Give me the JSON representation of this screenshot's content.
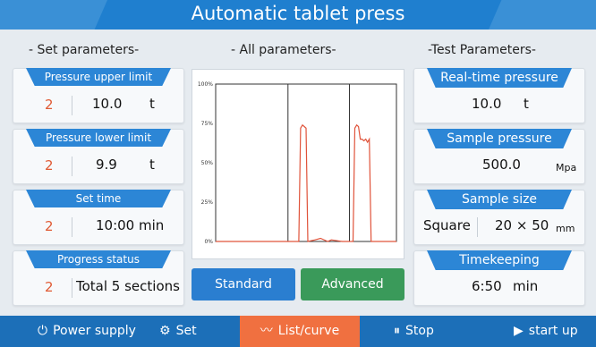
{
  "header": {
    "title": "Automatic tablet press"
  },
  "sections": {
    "set": "- Set parameters-",
    "all": "- All parameters-",
    "test": "-Test Parameters-"
  },
  "set_params": [
    {
      "label": "Pressure upper limit",
      "index": "2",
      "value": "10.0",
      "unit": "t"
    },
    {
      "label": "Pressure lower limit",
      "index": "2",
      "value": "9.9",
      "unit": "t"
    },
    {
      "label": "Set time",
      "index": "2",
      "value": "10:00",
      "unit": "min"
    },
    {
      "label": "Progress status",
      "index": "2",
      "value": "Total 5 sections",
      "unit": ""
    }
  ],
  "test_params": [
    {
      "label": "Real-time pressure",
      "value": "10.0",
      "unit": "t"
    },
    {
      "label": "Sample pressure",
      "value": "500.0",
      "unit": "Mpa"
    },
    {
      "label": "Sample size",
      "shape": "Square",
      "value": "20 × 50",
      "unit": "mm"
    },
    {
      "label": "Timekeeping",
      "value": "6:50",
      "unit": "min"
    }
  ],
  "chart_data": {
    "type": "line",
    "ytick_labels": [
      "100%",
      "75%",
      "50%",
      "25%",
      "0%"
    ],
    "ylim": [
      0,
      100
    ],
    "xlim": [
      0,
      100
    ],
    "section_boundaries": [
      40,
      74
    ],
    "series": [
      {
        "color": "#e0533a",
        "x": [
          0,
          38,
          44,
          46,
          47,
          48,
          49,
          50,
          51,
          55,
          58,
          62,
          64,
          70,
          74,
          76,
          77,
          78,
          79,
          80,
          81,
          82,
          83,
          84,
          85,
          86,
          88,
          100
        ],
        "y": [
          0,
          0,
          0,
          0,
          72,
          74,
          73,
          72,
          0,
          1,
          2,
          0,
          1,
          0,
          0,
          0,
          72,
          74,
          73,
          65,
          65,
          64,
          65,
          63,
          65,
          0,
          0,
          0
        ]
      }
    ]
  },
  "buttons": {
    "standard": "Standard",
    "advanced": "Advanced"
  },
  "footer": {
    "power": "Power supply",
    "set": "Set",
    "list": "List/curve",
    "stop": "Stop",
    "start": "start up"
  },
  "colors": {
    "accent": "#2c86d6",
    "index": "#e05a34",
    "curve": "#e0533a",
    "active_tab": "#f07040",
    "advanced": "#3a9a5a"
  }
}
